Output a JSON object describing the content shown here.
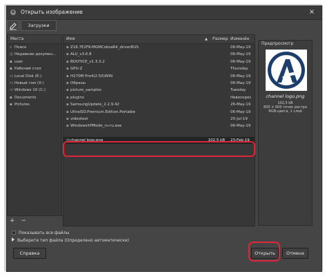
{
  "window": {
    "title": "Открыть изображение",
    "close_label": "×"
  },
  "path_bar": {
    "current_folder": "Загрузки"
  },
  "places": {
    "header": "Места",
    "items": [
      {
        "icon": "search-icon",
        "label": "Поиск"
      },
      {
        "icon": "recent-icon",
        "label": "Недавние докумен..."
      },
      {
        "icon": "folder-icon",
        "label": "user"
      },
      {
        "icon": "folder-icon",
        "label": "Рабочий стол"
      },
      {
        "icon": "drive-icon",
        "label": "Local Disk (E:)"
      },
      {
        "icon": "drive-icon",
        "label": "Новый том (X:)"
      },
      {
        "icon": "drive-icon",
        "label": "Windows 10 (C:)"
      },
      {
        "icon": "folder-icon",
        "label": "Documents"
      },
      {
        "icon": "folder-icon",
        "label": "Pictures"
      }
    ],
    "add_label": "+",
    "remove_label": "−"
  },
  "files": {
    "columns": {
      "name": "Имя",
      "size": "Размер",
      "modified": "Изменён",
      "sort_indicator": "▲"
    },
    "rows": [
      {
        "name": "Z18.7E2FK-MGMCobraR4_driverRUS",
        "size": "",
        "date": "06-May-19"
      },
      {
        "name": "ALU_v3.6.8",
        "size": "",
        "date": "06-May-19"
      },
      {
        "name": "BOOTICE_v1.3.3.2",
        "size": "",
        "date": "06-May-19"
      },
      {
        "name": "GPU-Z",
        "size": "",
        "date": "Thursday"
      },
      {
        "name": "H270M Pro4(2.50)WIN",
        "size": "",
        "date": "06-May-19"
      },
      {
        "name": "Образы",
        "size": "",
        "date": "06-May-19"
      },
      {
        "name": "picture_samples",
        "size": "",
        "date": "Tuesday"
      },
      {
        "name": "plugins",
        "size": "",
        "date": "Невоскрес"
      },
      {
        "name": "SamsungUpdate_2.2.9.42",
        "size": "",
        "date": "26-May-19"
      },
      {
        "name": "UltraISO.Premium.Edition.Portable",
        "size": "",
        "date": "06-May-19"
      },
      {
        "name": "videotest",
        "size": "",
        "date": "25-Jul-19"
      },
      {
        "name": "WindowsXPMode_ru-ru.exe",
        "size": "",
        "date": "06-May-19"
      },
      {
        "name": "",
        "size": "",
        "date": ""
      },
      {
        "name": "channel logo.png",
        "size": "102.5 kB",
        "date": "23-Feb-19",
        "selected": true
      },
      {
        "name": "",
        "size": "",
        "date": ""
      }
    ]
  },
  "preview": {
    "header": "Предпросмотр",
    "file_name": "channel logo.png",
    "file_size": "102,5 kB",
    "dimensions": "600 × 600 точек растра",
    "mode": "RGB-цвета, 1 слой"
  },
  "options": {
    "show_all_files": "Показывать все файлы",
    "select_file_type": "Выберите тип файла (Определено автоматически)"
  },
  "buttons": {
    "help": "Справка",
    "open": "Открыть",
    "cancel": "Отмена"
  },
  "colors": {
    "accent_red": "#e0253a",
    "logo_blue": "#1d3d6b"
  }
}
